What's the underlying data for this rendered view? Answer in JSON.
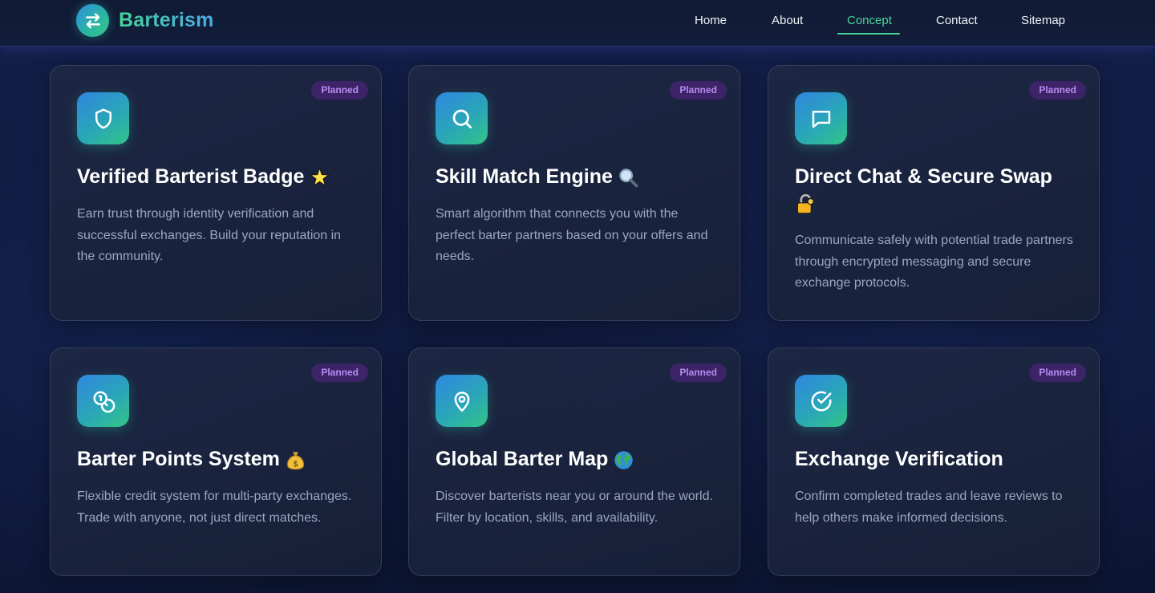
{
  "brand": {
    "name": "Barterism",
    "logo_icon": "swap-arrows-icon"
  },
  "nav": {
    "items": [
      {
        "label": "Home"
      },
      {
        "label": "About"
      },
      {
        "label": "Concept",
        "active": true
      },
      {
        "label": "Contact"
      },
      {
        "label": "Sitemap"
      }
    ]
  },
  "colors": {
    "accent_green": "#48d596",
    "accent_blue": "#2f86e0",
    "badge_bg": "#3d2468",
    "badge_text": "#b68cf0",
    "background": "#0f1a3c"
  },
  "features": [
    {
      "icon": "shield-icon",
      "badge": "Planned",
      "title": "Verified Barterist Badge",
      "emoji": "star-emoji",
      "description": "Earn trust through identity verification and successful exchanges. Build your reputation in the community."
    },
    {
      "icon": "search-icon",
      "badge": "Planned",
      "title": "Skill Match Engine",
      "emoji": "magnifier-emoji",
      "description": "Smart algorithm that connects you with the perfect barter partners based on your offers and needs."
    },
    {
      "icon": "chat-icon",
      "badge": "Planned",
      "title": "Direct Chat & Secure Swap",
      "emoji": "lock-emoji",
      "description": "Communicate safely with potential trade partners through encrypted messaging and secure exchange protocols."
    },
    {
      "icon": "coins-icon",
      "badge": "Planned",
      "title": "Barter Points System",
      "emoji": "money-bag-emoji",
      "description": "Flexible credit system for multi-party exchanges. Trade with anyone, not just direct matches."
    },
    {
      "icon": "map-pin-icon",
      "badge": "Planned",
      "title": "Global Barter Map",
      "emoji": "globe-emoji",
      "description": "Discover barterists near you or around the world. Filter by location, skills, and availability."
    },
    {
      "icon": "check-circle-icon",
      "badge": "Planned",
      "title": "Exchange Verification",
      "emoji": "",
      "description": "Confirm completed trades and leave reviews to help others make informed decisions."
    }
  ]
}
